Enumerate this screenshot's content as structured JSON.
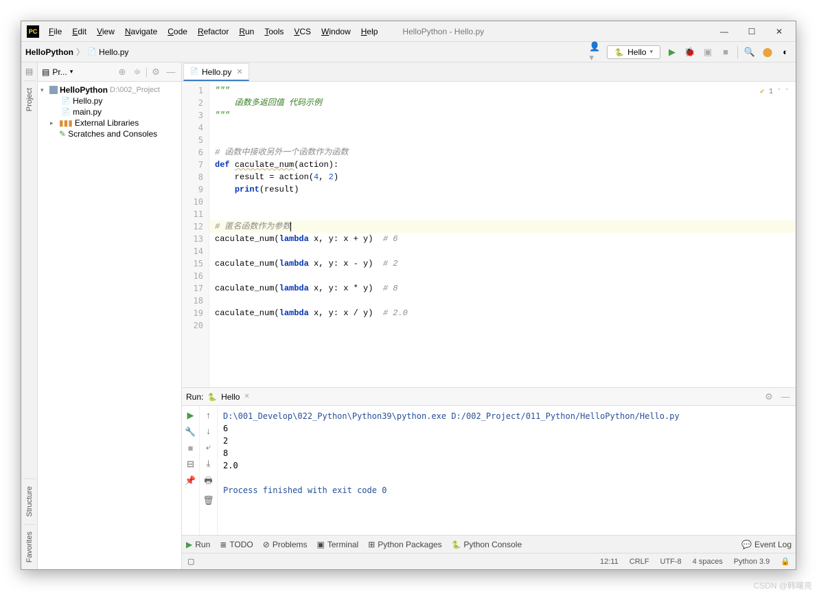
{
  "window": {
    "title": "HelloPython - Hello.py"
  },
  "menu": [
    "File",
    "Edit",
    "View",
    "Navigate",
    "Code",
    "Refactor",
    "Run",
    "Tools",
    "VCS",
    "Window",
    "Help"
  ],
  "breadcrumb": {
    "root": "HelloPython",
    "file": "Hello.py"
  },
  "run_config": {
    "name": "Hello"
  },
  "project": {
    "panel_title": "Pr...",
    "root": {
      "name": "HelloPython",
      "path": "D:\\002_Project"
    },
    "files": [
      "Hello.py",
      "main.py"
    ],
    "external": "External Libraries",
    "scratches": "Scratches and Consoles"
  },
  "editor": {
    "tab": "Hello.py",
    "inspection_count": "1",
    "lines": [
      {
        "n": 1,
        "segs": [
          {
            "t": "\"\"\"",
            "c": "doc"
          }
        ]
      },
      {
        "n": 2,
        "segs": [
          {
            "t": "    函数多返回值 代码示例",
            "c": "doc"
          }
        ]
      },
      {
        "n": 3,
        "segs": [
          {
            "t": "\"\"\"",
            "c": "doc"
          }
        ]
      },
      {
        "n": 4,
        "segs": [
          {
            "t": "",
            "c": ""
          }
        ]
      },
      {
        "n": 5,
        "segs": [
          {
            "t": "",
            "c": ""
          }
        ]
      },
      {
        "n": 6,
        "segs": [
          {
            "t": "# 函数中接收另外一个函数作为函数",
            "c": "cmt"
          }
        ]
      },
      {
        "n": 7,
        "segs": [
          {
            "t": "def ",
            "c": "kw"
          },
          {
            "t": "caculate_num",
            "c": "fn underline"
          },
          {
            "t": "(action):",
            "c": ""
          }
        ]
      },
      {
        "n": 8,
        "segs": [
          {
            "t": "    result = action(",
            "c": ""
          },
          {
            "t": "4",
            "c": "num"
          },
          {
            "t": ", ",
            "c": ""
          },
          {
            "t": "2",
            "c": "num"
          },
          {
            "t": ")",
            "c": ""
          }
        ]
      },
      {
        "n": 9,
        "segs": [
          {
            "t": "    ",
            "c": ""
          },
          {
            "t": "print",
            "c": "kw"
          },
          {
            "t": "(result)",
            "c": ""
          }
        ]
      },
      {
        "n": 10,
        "segs": [
          {
            "t": "",
            "c": ""
          }
        ]
      },
      {
        "n": 11,
        "segs": [
          {
            "t": "",
            "c": ""
          }
        ]
      },
      {
        "n": 12,
        "hl": true,
        "segs": [
          {
            "t": "# 匿名函数作为参数",
            "c": "cmt"
          }
        ],
        "caret": true
      },
      {
        "n": 13,
        "segs": [
          {
            "t": "caculate_num(",
            "c": ""
          },
          {
            "t": "lambda ",
            "c": "kw"
          },
          {
            "t": "x, y: x + y)  ",
            "c": ""
          },
          {
            "t": "# 6",
            "c": "cmt"
          }
        ]
      },
      {
        "n": 14,
        "segs": [
          {
            "t": "",
            "c": ""
          }
        ]
      },
      {
        "n": 15,
        "segs": [
          {
            "t": "caculate_num(",
            "c": ""
          },
          {
            "t": "lambda ",
            "c": "kw"
          },
          {
            "t": "x, y: x - y)  ",
            "c": ""
          },
          {
            "t": "# 2",
            "c": "cmt"
          }
        ]
      },
      {
        "n": 16,
        "segs": [
          {
            "t": "",
            "c": ""
          }
        ]
      },
      {
        "n": 17,
        "segs": [
          {
            "t": "caculate_num(",
            "c": ""
          },
          {
            "t": "lambda ",
            "c": "kw"
          },
          {
            "t": "x, y: x * y)  ",
            "c": ""
          },
          {
            "t": "# 8",
            "c": "cmt"
          }
        ]
      },
      {
        "n": 18,
        "segs": [
          {
            "t": "",
            "c": ""
          }
        ]
      },
      {
        "n": 19,
        "segs": [
          {
            "t": "caculate_num(",
            "c": ""
          },
          {
            "t": "lambda ",
            "c": "kw"
          },
          {
            "t": "x, y: x / y)  ",
            "c": ""
          },
          {
            "t": "# 2.0",
            "c": "cmt"
          }
        ]
      },
      {
        "n": 20,
        "segs": [
          {
            "t": "",
            "c": ""
          }
        ]
      }
    ]
  },
  "run": {
    "label": "Run:",
    "tab": "Hello",
    "cmd": "D:\\001_Develop\\022_Python\\Python39\\python.exe D:/002_Project/011_Python/HelloPython/Hello.py",
    "output": [
      "6",
      "2",
      "8",
      "2.0"
    ],
    "exit": "Process finished with exit code 0"
  },
  "bottom_tools": {
    "run": "Run",
    "todo": "TODO",
    "problems": "Problems",
    "terminal": "Terminal",
    "packages": "Python Packages",
    "console": "Python Console",
    "event_log": "Event Log"
  },
  "status": {
    "pos": "12:11",
    "eol": "CRLF",
    "enc": "UTF-8",
    "indent": "4 spaces",
    "interp": "Python 3.9"
  },
  "side_tabs": {
    "project": "Project",
    "structure": "Structure",
    "favorites": "Favorites"
  },
  "watermark": "CSDN @韩曙亮"
}
